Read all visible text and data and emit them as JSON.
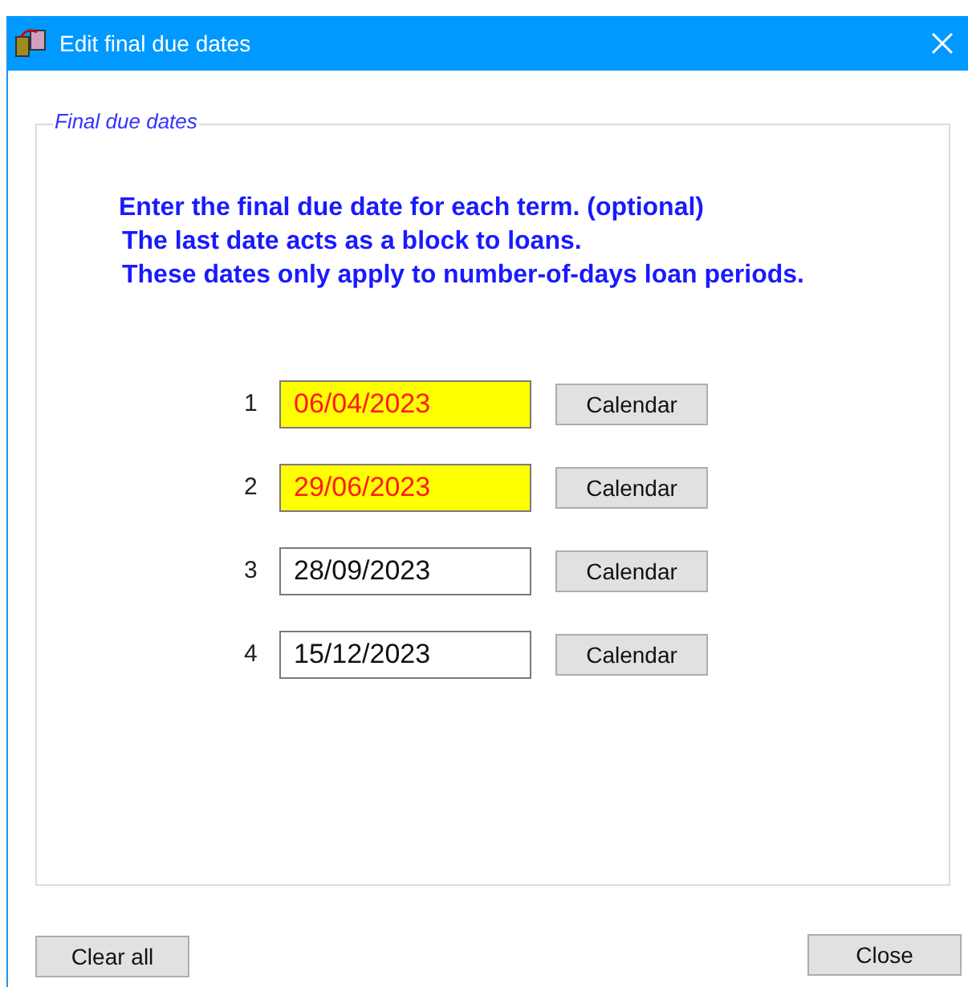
{
  "window": {
    "title": "Edit final due dates"
  },
  "group": {
    "title": "Final due dates",
    "instructions": [
      "Enter the final due date for each term. (optional)",
      "The last date acts as a block to loans.",
      "These dates only apply to number-of-days loan periods."
    ],
    "rows": [
      {
        "number": "1",
        "value": "06/04/2023",
        "highlighted": true,
        "button": "Calendar"
      },
      {
        "number": "2",
        "value": "29/06/2023",
        "highlighted": true,
        "button": "Calendar"
      },
      {
        "number": "3",
        "value": "28/09/2023",
        "highlighted": false,
        "button": "Calendar"
      },
      {
        "number": "4",
        "value": "15/12/2023",
        "highlighted": false,
        "button": "Calendar"
      }
    ]
  },
  "buttons": [
    "Clear all",
    "Close"
  ]
}
